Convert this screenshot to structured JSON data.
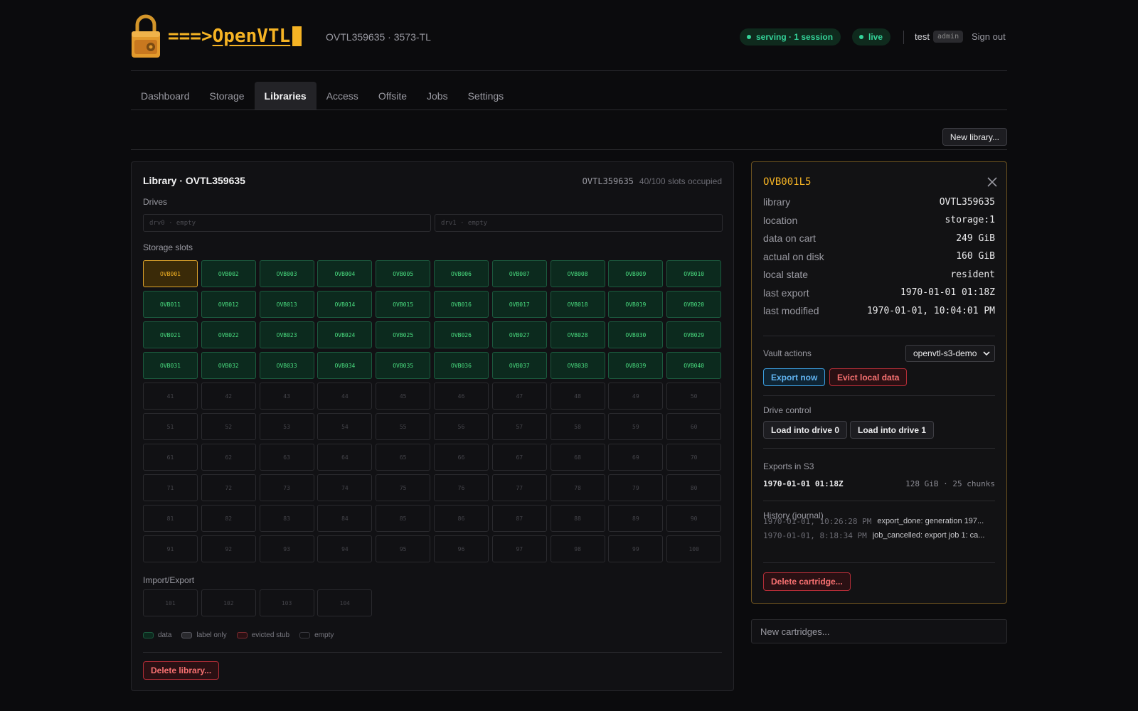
{
  "header": {
    "brand_arrow": "===>",
    "brand_name": "OpenVTL",
    "subtitle": "OVTL359635 · 3573-TL",
    "status_pill": "serving · 1 session",
    "live_pill": "live",
    "user": "test",
    "role": "admin",
    "signout": "Sign out",
    "status_color": "#34d399",
    "brand_color": "#f5b324"
  },
  "nav": {
    "tabs": [
      {
        "label": "Dashboard",
        "active": false
      },
      {
        "label": "Storage",
        "active": false
      },
      {
        "label": "Libraries",
        "active": true
      },
      {
        "label": "Access",
        "active": false
      },
      {
        "label": "Offsite",
        "active": false
      },
      {
        "label": "Jobs",
        "active": false
      },
      {
        "label": "Settings",
        "active": false
      }
    ]
  },
  "toolbar": {
    "new_library": "New library..."
  },
  "library": {
    "title": "Library · OVTL359635",
    "id": "OVTL359635",
    "occupancy": "40/100 slots occupied",
    "drives_label": "Drives",
    "drives": [
      "drv0 · empty",
      "drv1 · empty"
    ],
    "slots_label": "Storage slots",
    "slots": [
      "OVB001",
      "OVB002",
      "OVB003",
      "OVB004",
      "OVB005",
      "OVB006",
      "OVB007",
      "OVB008",
      "OVB009",
      "OVB010",
      "OVB011",
      "OVB012",
      "OVB013",
      "OVB014",
      "OVB015",
      "OVB016",
      "OVB017",
      "OVB018",
      "OVB019",
      "OVB020",
      "OVB021",
      "OVB022",
      "OVB023",
      "OVB024",
      "OVB025",
      "OVB026",
      "OVB027",
      "OVB028",
      "OVB030",
      "OVB029",
      "OVB031",
      "OVB032",
      "OVB033",
      "OVB034",
      "OVB035",
      "OVB036",
      "OVB037",
      "OVB038",
      "OVB039",
      "OVB040",
      "41",
      "42",
      "43",
      "44",
      "45",
      "46",
      "47",
      "48",
      "49",
      "50",
      "51",
      "52",
      "53",
      "54",
      "55",
      "56",
      "57",
      "58",
      "59",
      "60",
      "61",
      "62",
      "63",
      "64",
      "65",
      "66",
      "67",
      "68",
      "69",
      "70",
      "71",
      "72",
      "73",
      "74",
      "75",
      "76",
      "77",
      "78",
      "79",
      "80",
      "81",
      "82",
      "83",
      "84",
      "85",
      "86",
      "87",
      "88",
      "89",
      "90",
      "91",
      "92",
      "93",
      "94",
      "95",
      "96",
      "97",
      "98",
      "99",
      "100"
    ],
    "selected_slot": "OVB001",
    "import_export_label": "Import/Export",
    "ie_slots": [
      "101",
      "102",
      "103",
      "104"
    ],
    "legend": [
      {
        "label": "data",
        "color": "#0c2a1e",
        "border": "#1b5a3e"
      },
      {
        "label": "label only",
        "color": "#2a2a2e",
        "border": "#55555c"
      },
      {
        "label": "evicted stub",
        "color": "#2a1013",
        "border": "#7a2a30"
      },
      {
        "label": "empty",
        "color": "#111114",
        "border": "#3a3a40"
      }
    ],
    "delete_button": "Delete library..."
  },
  "detail": {
    "title": "OVB001L5",
    "fields": [
      {
        "key": "library",
        "value": "OVTL359635"
      },
      {
        "key": "location",
        "value": "storage:1"
      },
      {
        "key": "data on cart",
        "value": "249 GiB"
      },
      {
        "key": "actual on disk",
        "value": "160 GiB"
      },
      {
        "key": "local state",
        "value": "resident"
      },
      {
        "key": "last export",
        "value": "1970-01-01 01:18Z"
      },
      {
        "key": "last modified",
        "value": "1970-01-01, 10:04:01 PM"
      }
    ],
    "vault_label": "Vault actions",
    "vault_target": "openvtl-s3-demo",
    "export_now": "Export now",
    "evict": "Evict local data",
    "drive_control_label": "Drive control",
    "load0": "Load into drive 0",
    "load1": "Load into drive 1",
    "exports_label": "Exports in S3",
    "export_time": "1970-01-01 01:18Z",
    "export_size": "128 GiB · 25 chunks",
    "history_label": "History (journal)",
    "history": [
      {
        "time": "1970-01-01, 10:26:28 PM",
        "msg": "export_done: generation 197..."
      },
      {
        "time": "1970-01-01, 8:18:34 PM",
        "msg": "job_cancelled: export job 1: ca..."
      }
    ],
    "delete_cartridge": "Delete cartridge..."
  },
  "new_cartridges": {
    "placeholder": "New cartridges..."
  }
}
